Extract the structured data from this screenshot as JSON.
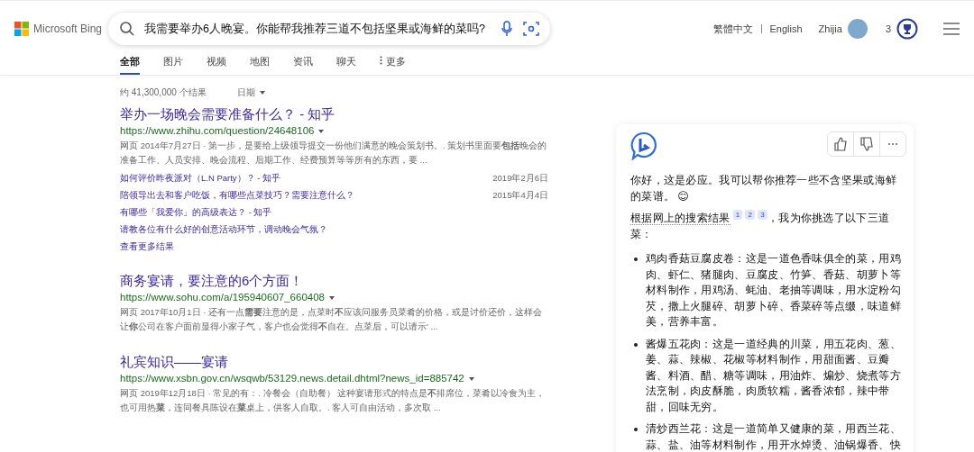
{
  "header": {
    "logo": "Microsoft Bing",
    "query": "我需要举办6人晚宴。你能帮我推荐三道不包括坚果或海鲜的菜吗?",
    "languages": [
      "繁體中文",
      "English"
    ],
    "user_name": "Zhijia",
    "rewards_count": "3"
  },
  "tabs": [
    {
      "label": "全部",
      "selected": true
    },
    {
      "label": "图片",
      "selected": false
    },
    {
      "label": "视频",
      "selected": false
    },
    {
      "label": "地图",
      "selected": false
    },
    {
      "label": "资讯",
      "selected": false
    },
    {
      "label": "聊天",
      "selected": false
    },
    {
      "label": "更多",
      "selected": false,
      "kind": "more"
    }
  ],
  "results_info": {
    "count": "约 41,300,000 个结果",
    "filter": "日期"
  },
  "results": [
    {
      "title": "举办一场晚会需要准备什么？ - 知乎",
      "url": "https://www.zhihu.com/question/24648106",
      "snippet": "网页 2014年7月27日 · 第一步，是要给上级领导提交一份他们满意的晚会策划书。. 策划书里面要**包括**晚会的准备工作、人员安排、晚会流程、后期工作、经费预算等等所有的东西，要 ...",
      "sublinks": [
        {
          "text": "如何评价昨夜派对（L.N Party）？ - 知乎",
          "date": "2019年2月6日"
        },
        {
          "text": "陪领导出去和客户吃饭，有哪些点菜技巧？需要注意什么？",
          "date": "2015年4月4日"
        },
        {
          "text": "有哪些「我爱你」的高级表达？ - 知乎"
        },
        {
          "text": "请教各位有什么好的创意活动环节，调动晚会气氛？"
        }
      ],
      "more": "查看更多结果"
    },
    {
      "title": "商务宴请，要注意的6个方面！",
      "url": "https://www.sohu.com/a/195940607_660408",
      "snippet": "网页 2017年10月1日 · 还有一点**需要**注意的是，点菜时**不**应该问服务员菜肴的价格，或是讨价还价，这样会让**你**公司在客户面前显得小家子气，客户也会觉得**不**自在。点菜后，可以请示' ..."
    },
    {
      "title": "礼宾知识——宴请",
      "url": "https://www.xsbn.gov.cn/wsqwb/53129.news.detail.dhtml?news_id=885742",
      "snippet": "网页 2019年12月18日 · 常见的有：. 冷餐会（自助餐） 这种宴请形式的特点是**不**排席位，菜肴以冷食为主，也可用热**菜**，连同餐具陈设在**菜**桌上，供客人自取。. 客人可自由活动，多次取 ..."
    }
  ],
  "chat": {
    "greeting": "你好，这是必应。我可以帮你推荐一些不含坚果或海鲜的菜谱。",
    "emoji": "😊",
    "sources_text": "根据网上的搜索结果",
    "citations": [
      "1",
      "2",
      "3"
    ],
    "intro_rest": "，我为你挑选了以下三道菜：",
    "dishes": [
      "鸡肉香菇豆腐皮卷：这是一道色香味俱全的菜，用鸡肉、虾仁、猪腿肉、豆腐皮、竹笋、香菇、胡萝卜等材料制作，用鸡汤、蚝油、老抽等调味，用水淀粉勾芡，撒上火腿碎、胡萝卜碎、香菜碎等点缀，味道鲜美，营养丰富。",
      "酱爆五花肉：这是一道经典的川菜，用五花肉、葱、姜、蒜、辣椒、花椒等材料制作，用甜面酱、豆瓣酱、料酒、醋、糖等调味，用油炸、煸炒、烧煮等方法烹制，肉皮酥脆，肉质软糯，酱香浓郁，辣中带甜，回味无穷。",
      "清炒西兰花：这是一道简单又健康的菜，用西兰花、蒜、盐、油等材料制作，用开水焯烫、油锅爆香、快"
    ]
  }
}
